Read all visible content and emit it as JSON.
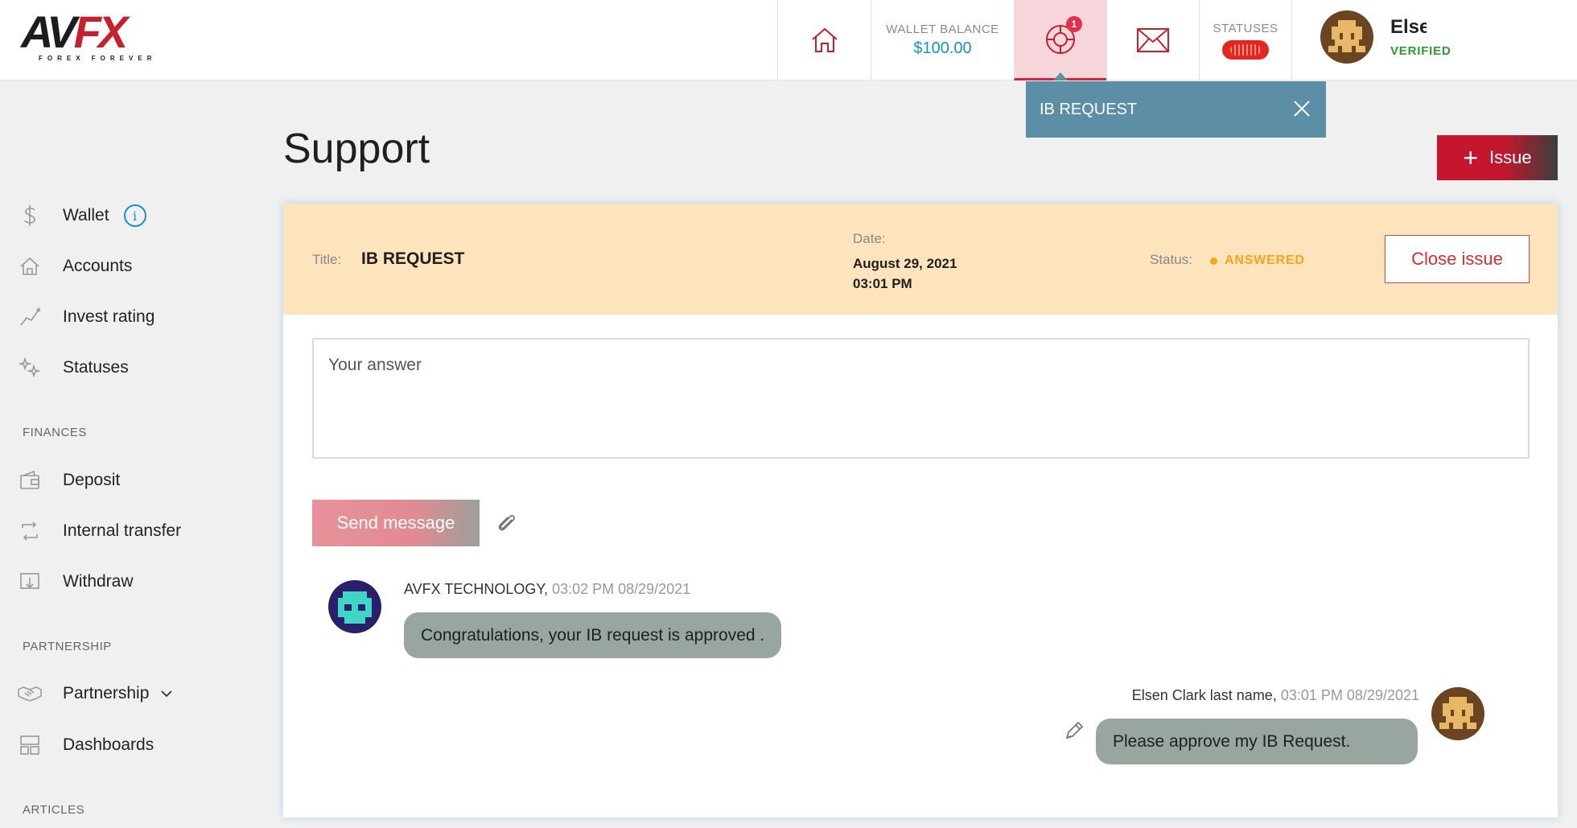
{
  "brand": {
    "logo_main": "AVFX",
    "logo_sub": "FOREX FOREVER"
  },
  "header": {
    "wallet_label": "WALLET BALANCE",
    "wallet_value": "$100.00",
    "support_badge": "1",
    "statuses_label": "STATUSES",
    "user_name": "Else",
    "user_status": "VERIFIED"
  },
  "tooltip": {
    "text": "IB REQUEST"
  },
  "sidebar": {
    "items": [
      {
        "label": "Wallet",
        "icon": "dollar-icon"
      },
      {
        "label": "Accounts",
        "icon": "home-icon"
      },
      {
        "label": "Invest rating",
        "icon": "chart-line-icon"
      },
      {
        "label": "Statuses",
        "icon": "sparkle-icon"
      }
    ],
    "finances_title": "FINANCES",
    "finances": [
      {
        "label": "Deposit",
        "icon": "wallet-icon"
      },
      {
        "label": "Internal transfer",
        "icon": "transfer-icon"
      },
      {
        "label": "Withdraw",
        "icon": "withdraw-icon"
      }
    ],
    "partnership_title": "PARTNERSHIP",
    "partnership": [
      {
        "label": "Partnership",
        "icon": "handshake-icon"
      },
      {
        "label": "Dashboards",
        "icon": "dashboard-icon"
      }
    ],
    "articles_title": "ARTICLES"
  },
  "page": {
    "title": "Support",
    "new_issue_label": "Issue"
  },
  "issue": {
    "title_label": "Title:",
    "title": "IB REQUEST",
    "date_label": "Date:",
    "date": "August 29, 2021",
    "time": "03:01 PM",
    "status_label": "Status:",
    "status": "ANSWERED",
    "close_label": "Close issue",
    "status_color": "#f4a51c"
  },
  "reply": {
    "placeholder": "Your answer",
    "send_label": "Send message"
  },
  "messages": [
    {
      "author": "AVFX TECHNOLOGY,",
      "time": "03:02 PM",
      "date": "08/29/2021",
      "text": "Congratulations, your IB request is approved ."
    },
    {
      "author": "Elsen Clark last name,",
      "time": "03:01 PM",
      "date": "08/29/2021",
      "text": "Please approve my IB Request."
    }
  ],
  "colors": {
    "brand_red": "#c81f2d",
    "accent_blue": "#1891c9",
    "tooltip_bg": "#5c8fa6",
    "issue_header_bg": "#fde4bd",
    "bubble_bg": "#99a59f"
  }
}
